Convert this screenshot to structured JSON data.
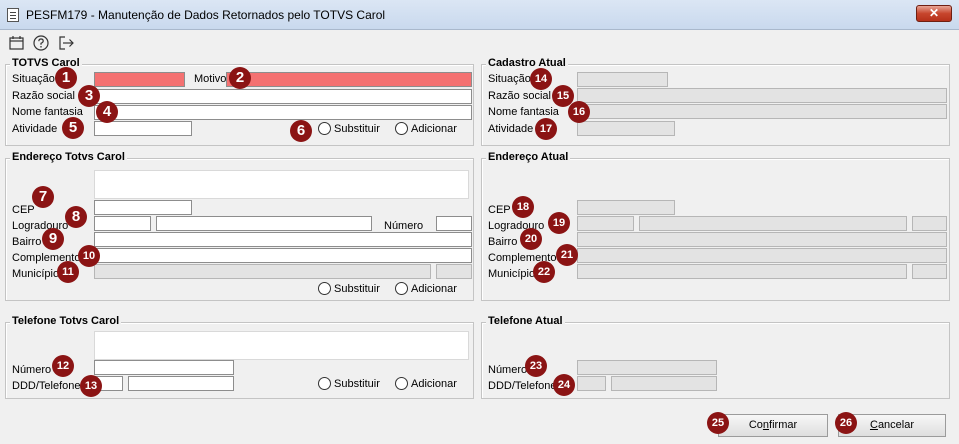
{
  "window": {
    "title": "PESFM179 - Manutenção de Dados Retornados pelo TOTVS Carol",
    "close_label": "✕"
  },
  "toolbar": {
    "icons": [
      "calendar-icon",
      "help-icon",
      "exit-icon"
    ]
  },
  "totvs_carol": {
    "legend": "TOTVS Carol",
    "situacao": "Situação",
    "motivo": "Motivo",
    "razao_social": "Razão social",
    "nome_fantasia": "Nome fantasia",
    "atividade": "Atividade",
    "substituir": "Substituir",
    "adicionar": "Adicionar"
  },
  "cadastro_atual": {
    "legend": "Cadastro Atual",
    "situacao": "Situação",
    "razao_social": "Razão social",
    "nome_fantasia": "Nome fantasia",
    "atividade": "Atividade"
  },
  "endereco_carol": {
    "legend": "Endereço Totvs Carol",
    "cep": "CEP",
    "logradouro": "Logradouro",
    "numero": "Número",
    "bairro": "Bairro",
    "complemento": "Complemento",
    "municipio": "Município",
    "substituir": "Substituir",
    "adicionar": "Adicionar"
  },
  "endereco_atual": {
    "legend": "Endereço Atual",
    "cep": "CEP",
    "logradouro": "Logradouro",
    "bairro": "Bairro",
    "complemento": "Complemento",
    "municipio": "Município"
  },
  "telefone_carol": {
    "legend": "Telefone Totvs Carol",
    "numero": "Número",
    "ddd_telefone": "DDD/Telefone",
    "substituir": "Substituir",
    "adicionar": "Adicionar"
  },
  "telefone_atual": {
    "legend": "Telefone Atual",
    "numero": "Número",
    "ddd_telefone": "DDD/Telefone"
  },
  "buttons": {
    "confirmar_pre": "Co",
    "confirmar_u": "n",
    "confirmar_post": "firmar",
    "cancelar_pre": "",
    "cancelar_u": "C",
    "cancelar_post": "ancelar"
  },
  "markers": [
    "1",
    "2",
    "3",
    "4",
    "5",
    "6",
    "7",
    "8",
    "9",
    "10",
    "11",
    "12",
    "13",
    "14",
    "15",
    "16",
    "17",
    "18",
    "19",
    "20",
    "21",
    "22",
    "23",
    "24",
    "25",
    "26"
  ],
  "colors": {
    "required_field": "#f47171",
    "marker": "#8b1414"
  }
}
